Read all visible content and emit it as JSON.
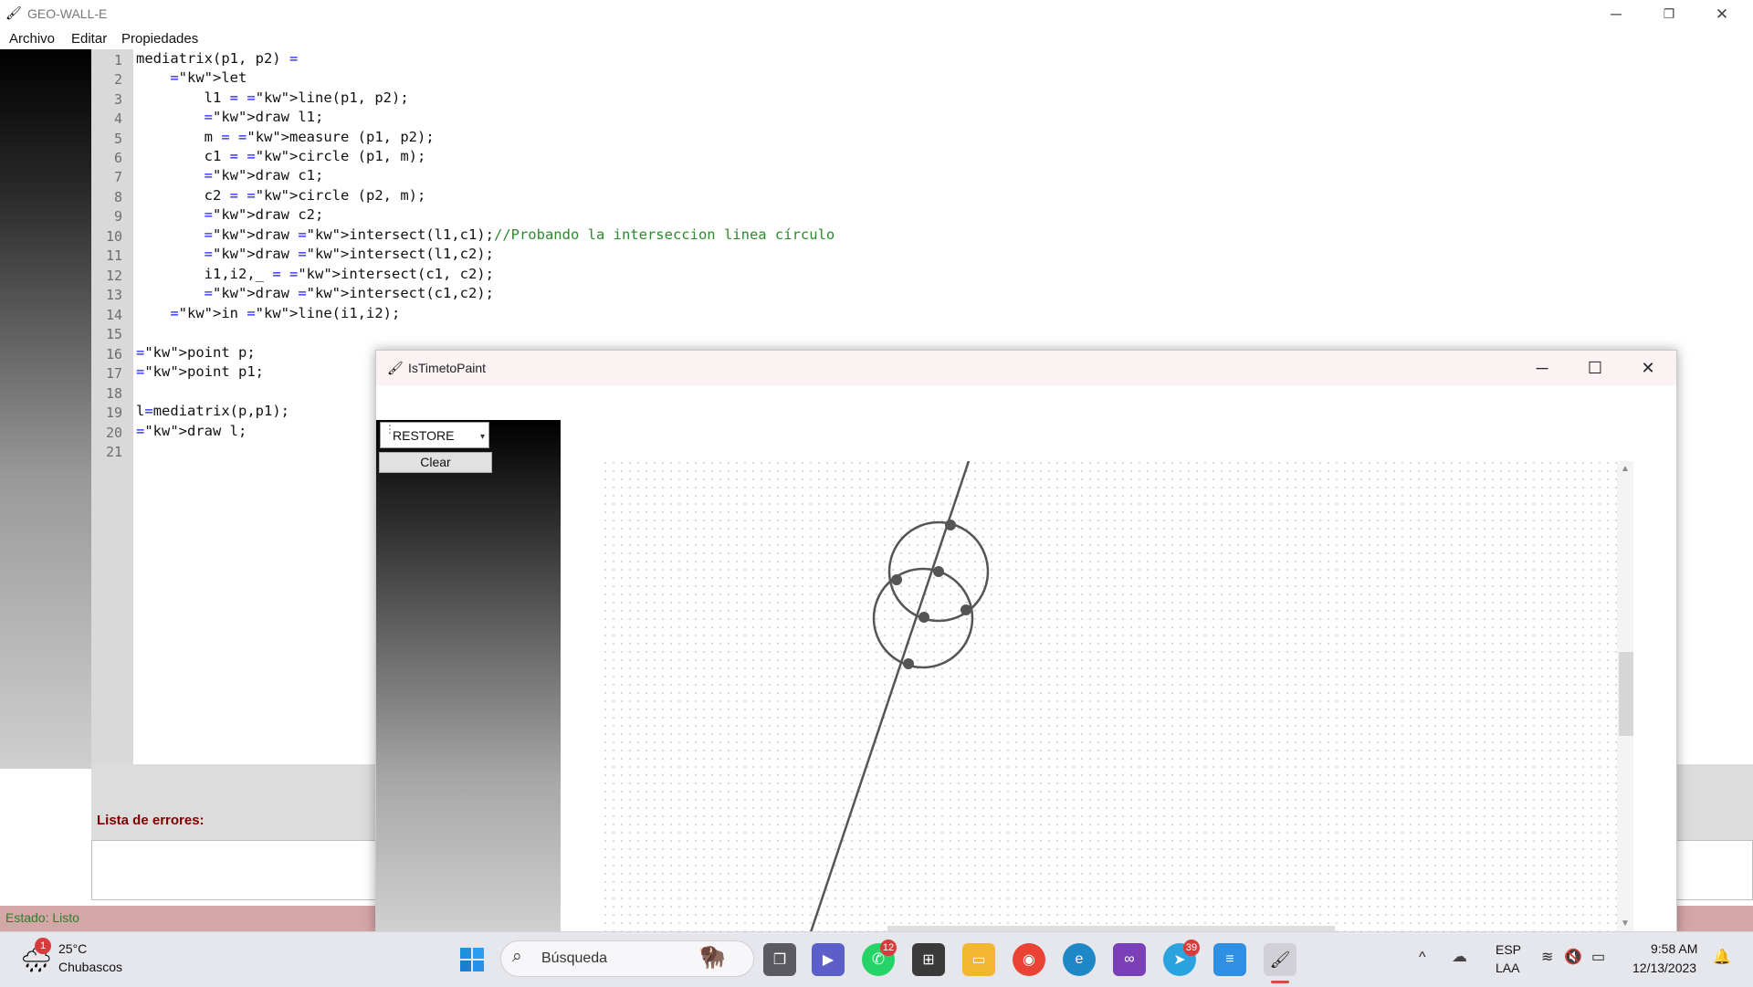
{
  "app": {
    "title": "GEO-WALL-E",
    "menu": [
      "Archivo",
      "Editar",
      "Propiedades"
    ]
  },
  "editor": {
    "line_numbers": [
      "1",
      "2",
      "3",
      "4",
      "5",
      "6",
      "7",
      "8",
      "9",
      "10",
      "11",
      "12",
      "13",
      "14",
      "15",
      "16",
      "17",
      "18",
      "19",
      "20",
      "21"
    ],
    "lines": [
      "mediatrix(p1, p2) =",
      "    let",
      "        l1 = line(p1, p2);",
      "        draw l1;",
      "        m = measure (p1, p2);",
      "        c1 = circle (p1, m);",
      "        draw c1;",
      "        c2 = circle (p2, m);",
      "        draw c2;",
      "        draw intersect(l1,c1);//Probando la interseccion linea círculo",
      "        draw intersect(l1,c2);",
      "        i1,i2,_ = intersect(c1, c2);",
      "        draw intersect(c1,c2);",
      "    in line(i1,i2);",
      "",
      "point p;",
      "point p1;",
      "",
      "l=mediatrix(p,p1);",
      "draw l;",
      ""
    ]
  },
  "errors": {
    "title": "Lista de errores:"
  },
  "status": {
    "text": "Estado: Listo"
  },
  "paint_window": {
    "title": "IsTimetoPaint",
    "mode_select": "RESTORE",
    "clear_label": "Clear"
  },
  "taskbar": {
    "weather": {
      "temp": "25°C",
      "desc": "Chubascos",
      "badge": "1"
    },
    "search_placeholder": "Búsqueda",
    "whatsapp_badge": "12",
    "telegram_badge": "39",
    "lang": {
      "top": "ESP",
      "bottom": "LAA"
    },
    "time": "9:58 AM",
    "date": "12/13/2023"
  },
  "colors": {
    "status_bar": "#d5a6a6",
    "error_title": "#800000",
    "keyword": "#1a1aff",
    "comment": "#2b8a2b"
  }
}
